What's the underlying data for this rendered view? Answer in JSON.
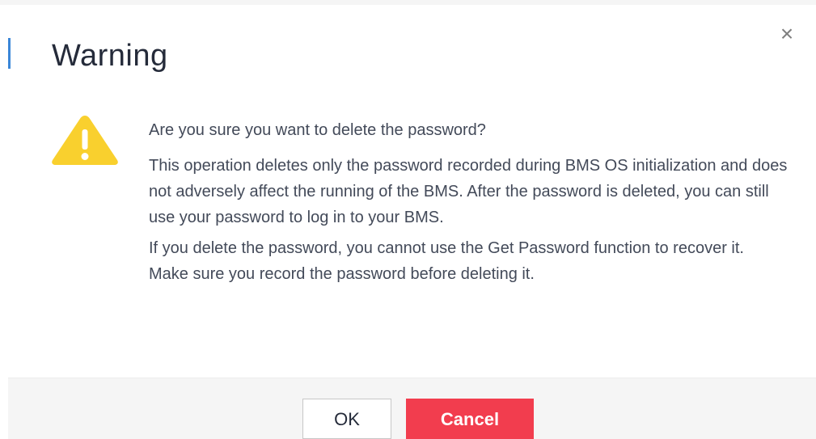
{
  "dialog": {
    "title": "Warning",
    "close_icon": "close-icon",
    "warning_icon": "warning-triangle-icon",
    "close_glyph": "×",
    "message": {
      "question": "Are you sure you want to delete the password?",
      "paragraph_1": "This operation deletes only the password recorded during BMS OS initialization and does not adversely affect the running of the BMS. After the password is deleted, you can still use your password to log in to your BMS.",
      "paragraph_2": "If you delete the password, you cannot use the Get Password function to recover it. Make sure you record the password before deleting it."
    },
    "buttons": {
      "ok_label": "OK",
      "cancel_label": "Cancel"
    },
    "colors": {
      "accent": "#3a86d8",
      "warning": "#f9d02e",
      "danger": "#f23d4e"
    }
  }
}
